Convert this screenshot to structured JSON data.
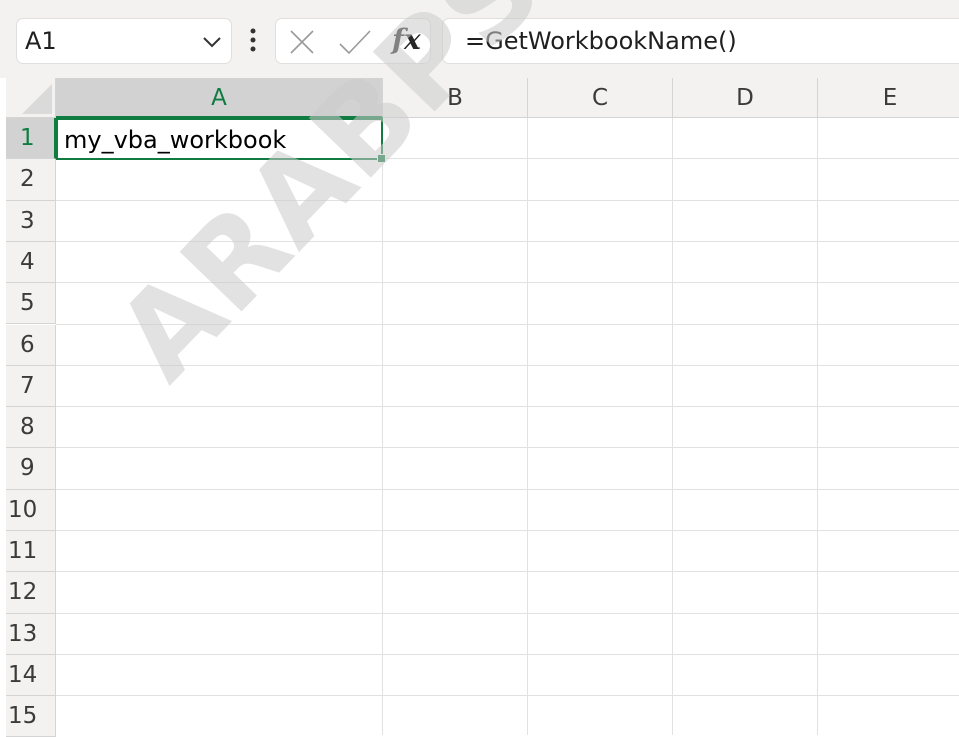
{
  "formula_bar": {
    "name_box": "A1",
    "formula": "=GetWorkbookName()",
    "fx_label": "fx",
    "icons": [
      "chevron-down-icon",
      "vertical-dots-icon",
      "cancel-icon",
      "enter-check-icon",
      "insert-function-icon"
    ]
  },
  "columns": [
    {
      "label": "A"
    },
    {
      "label": "B"
    },
    {
      "label": "C"
    },
    {
      "label": "D"
    },
    {
      "label": "E"
    }
  ],
  "rows": [
    "1",
    "2",
    "3",
    "4",
    "5",
    "6",
    "7",
    "8",
    "9",
    "10",
    "11",
    "12",
    "13",
    "14",
    "15"
  ],
  "cells": {
    "A1": "my_vba_workbook"
  },
  "selection": {
    "cell": "A1",
    "accent_color": "#107c41"
  },
  "watermark": "ARABPSYCHOLO"
}
